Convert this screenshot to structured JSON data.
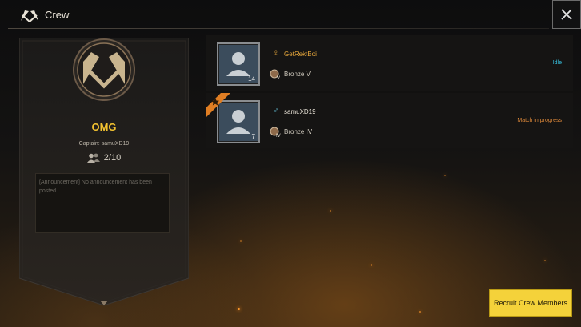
{
  "window": {
    "title": "Crew",
    "icons": {
      "crew_logo": "crossed-flags-icon",
      "close": "close-icon"
    }
  },
  "crew": {
    "name": "OMG",
    "captain": "Captain: samuXD19",
    "members_count": "2/10",
    "announcement": "[Announcement] No announcement has been posted",
    "emblem_icon": "crossed-flags-emblem-icon"
  },
  "members": [
    {
      "name": "GetRektBoi",
      "gender_symbol": "♀",
      "level": "14",
      "rank": "Bronze V",
      "rank_badge": "V",
      "status": "Idle",
      "is_captain": false
    },
    {
      "name": "samuXD19",
      "gender_symbol": "♂",
      "level": "7",
      "rank": "Bronze IV",
      "rank_badge": "IV",
      "status": "Match in progress",
      "is_captain": true
    }
  ],
  "actions": {
    "recruit": "Recruit Crew Members"
  },
  "colors": {
    "crew_name": "#f2c230",
    "female_name": "#e8a83c",
    "male_name": "#e8e2d6",
    "female_symbol": "#e8a83c",
    "male_symbol": "#5fb3c9",
    "status_idle": "#37c2e0",
    "status_match": "#e08a3a",
    "recruit_button": "#f4d23a"
  }
}
